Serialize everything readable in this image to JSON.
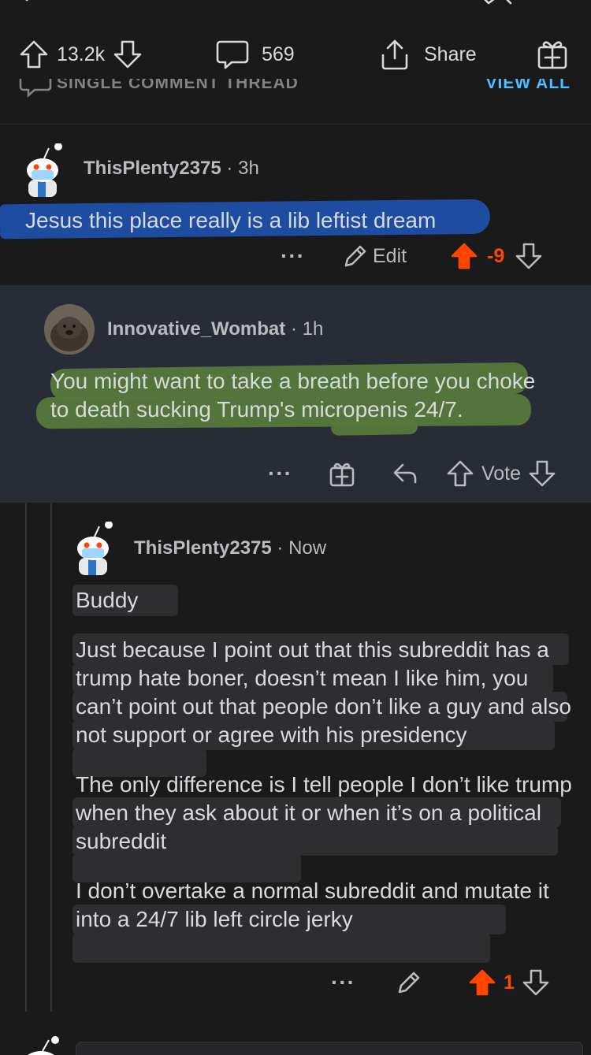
{
  "post_bar": {
    "upvotes": "13.2k",
    "comments": "569",
    "share_label": "Share"
  },
  "thread_bar": {
    "label": "SINGLE COMMENT THREAD",
    "view_all": "VIEW ALL"
  },
  "comments": [
    {
      "user": "ThisPlenty2375",
      "time": "3h",
      "text": "Jesus this place really is a lib leftist dream",
      "edit_label": "Edit",
      "score": "-9"
    },
    {
      "user": "Innovative_Wombat",
      "time": "1h",
      "text": "You might want to take a breath before you choke to death sucking Trump's micropenis 24/7.",
      "vote_label": "Vote"
    },
    {
      "user": "ThisPlenty2375",
      "time": "Now",
      "paragraphs": [
        "Buddy",
        "Just because I point out that this subreddit has a trump hate boner, doesn’t mean I like him, you can’t point out that people don’t like a guy and also not support or agree with his presidency",
        "The only difference is I tell people I don’t like trump when they ask about it or when it’s on a political subreddit",
        "I don’t overtake a normal subreddit and mutate it into a 24/7 lib left circle jerky"
      ],
      "score": "1"
    }
  ],
  "colors": {
    "background": "#1a1a1b",
    "reply_background": "#272c37",
    "upvote_orange": "#ff4500",
    "link_blue": "#4fbcff"
  },
  "icons": [
    "upvote-icon",
    "downvote-icon",
    "comment-icon",
    "share-icon",
    "gift-icon",
    "pencil-icon",
    "reply-icon",
    "more-icon"
  ]
}
